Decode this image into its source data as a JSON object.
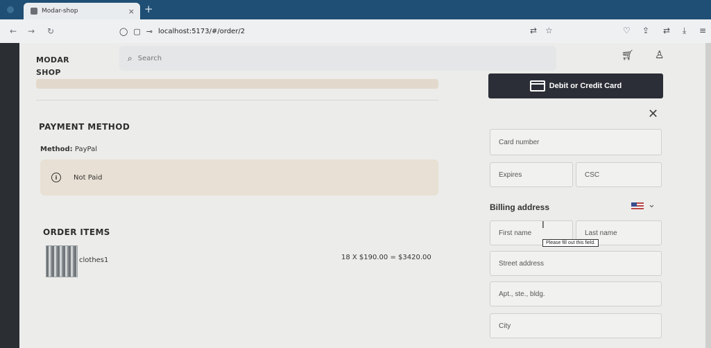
{
  "browser": {
    "tab_title": "Modar-shop",
    "tab_close": "×",
    "new_tab": "+",
    "url": "localhost:5173/#/order/2"
  },
  "header": {
    "brand": "MODAR SHOP",
    "search_placeholder": "Search"
  },
  "payment": {
    "title": "PAYMENT METHOD",
    "method_label": "Method:",
    "method_value": "PayPal",
    "status": "Not Paid"
  },
  "order_items": {
    "title": "ORDER ITEMS",
    "items": [
      {
        "name": "clothes1",
        "price_line": "18 X $190.00 = $3420.00"
      }
    ]
  },
  "card_form": {
    "button_label": "Debit or Credit Card",
    "card_number": "Card number",
    "expires": "Expires",
    "csc": "CSC",
    "billing_address": "Billing address",
    "first_name": "First name",
    "last_name": "Last name",
    "tooltip": "Please fill out this field.",
    "street": "Street address",
    "apt": "Apt., ste., bldg.",
    "city": "City"
  }
}
